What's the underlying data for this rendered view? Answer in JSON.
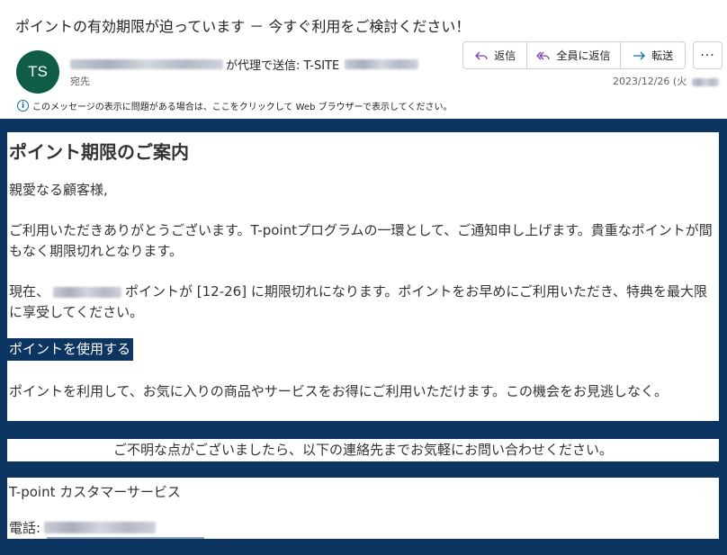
{
  "email": {
    "subject": "ポイントの有効期限が迫っています － 今すぐ利用をご検討ください！",
    "avatar_initials": "TS",
    "sender_on_behalf": "が代理で送信: T-SITE",
    "to_label": "宛先",
    "date": "2023/12/26 (火",
    "info_bar": "このメッセージの表示に問題がある場合は、ここをクリックして Web ブラウザーで表示してください。"
  },
  "actions": {
    "reply": "返信",
    "reply_all": "全員に返信",
    "forward": "転送",
    "more": "···"
  },
  "body": {
    "heading": "ポイント期限のご案内",
    "greeting": "親愛なる顧客様,",
    "thanks": "ご利用いただきありがとうございます。T-pointプログラムの一環として、ご通知申し上げます。貴重なポイントが間もなく期限切れとなります。",
    "current_prefix": "現在、",
    "current_suffix": "ポイントが [12-26] に期限切れになります。ポイントをお早めにご利用いただき、特典を最大限に享受してください。",
    "cta": "ポイントを使用する",
    "use_text": "ポイントを利用して、お気に入りの商品やサービスをお得にご利用いただけます。この機会をお見逃しなく。",
    "contact_note": "ご不明な点がございましたら、以下の連絡先までお気軽にお問い合わせください。",
    "service_name": "T-point カスタマーサービス",
    "phone_label": "電話:"
  },
  "colors": {
    "brand_navy": "#0d3561",
    "avatar_green": "#0f5d46",
    "accent_purple": "#7a3fb5",
    "info_blue": "#0f6cbd"
  }
}
